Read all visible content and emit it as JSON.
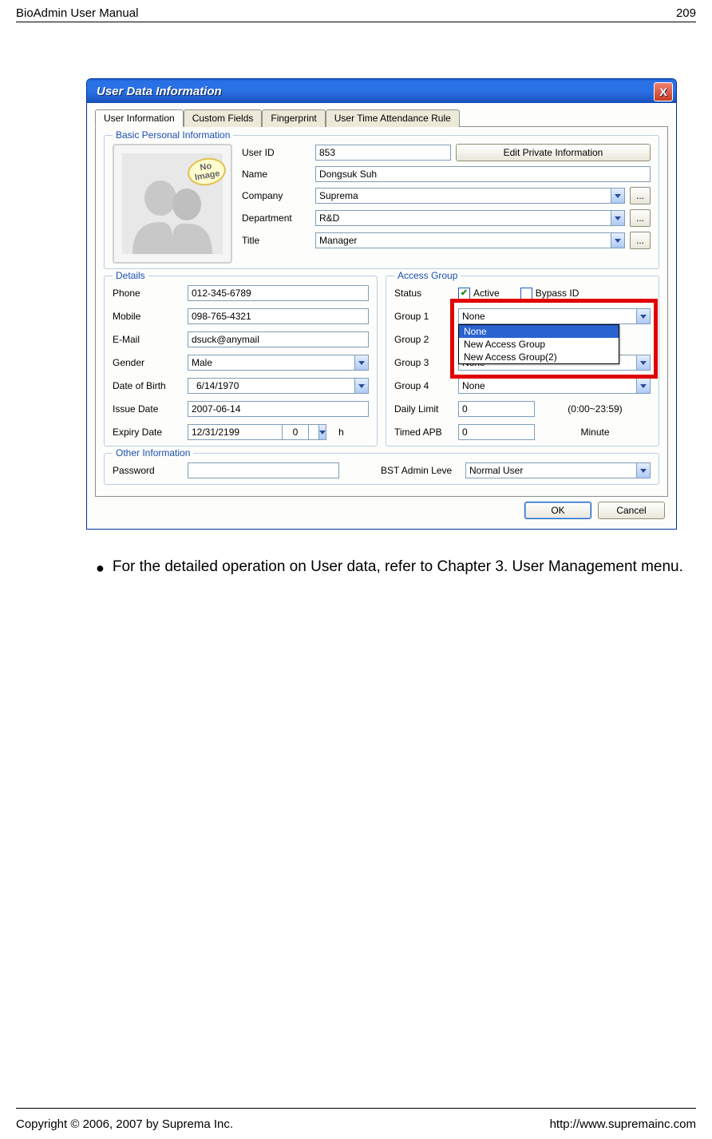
{
  "page": {
    "header_left": "BioAdmin User Manual",
    "header_right": "209",
    "footer_left": "Copyright © 2006, 2007 by Suprema Inc.",
    "footer_right": "http://www.supremainc.com"
  },
  "bullet_text": "For the detailed operation on User data, refer to Chapter 3. User Management menu.",
  "window": {
    "title": "User Data Information",
    "close_label": "X",
    "tabs": [
      {
        "label": "User Information",
        "active": true
      },
      {
        "label": "Custom Fields",
        "active": false
      },
      {
        "label": "Fingerprint",
        "active": false
      },
      {
        "label": "User Time Attendance Rule",
        "active": false
      }
    ],
    "groups": {
      "basic": {
        "legend": "Basic Personal Information",
        "no_image": "No Image",
        "btn_edit": "Edit Private Information",
        "user_id_label": "User ID",
        "user_id_value": "853",
        "name_label": "Name",
        "name_value": "Dongsuk Suh",
        "company_label": "Company",
        "company_value": "Suprema",
        "department_label": "Department",
        "department_value": "R&D",
        "title_label": "Title",
        "title_value": "Manager"
      },
      "details": {
        "legend": "Details",
        "phone_label": "Phone",
        "phone_value": "012-345-6789",
        "mobile_label": "Mobile",
        "mobile_value": "098-765-4321",
        "email_label": "E-Mail",
        "email_value": "dsuck@anymail",
        "gender_label": "Gender",
        "gender_value": "Male",
        "dob_label": "Date of Birth",
        "dob_value": "6/14/1970",
        "issue_label": "Issue Date",
        "issue_value": "2007-06-14",
        "expiry_label": "Expiry Date",
        "expiry_value": "12/31/2199",
        "expiry_hours": "0",
        "expiry_hours_unit": "h"
      },
      "access": {
        "legend": "Access Group",
        "status_label": "Status",
        "active_label": "Active",
        "active_checked": true,
        "bypass_label": "Bypass ID",
        "bypass_checked": false,
        "group1_label": "Group 1",
        "group1_value": "None",
        "group1_options": [
          "None",
          "New Access Group",
          "New Access Group(2)"
        ],
        "group1_selected_option": "None",
        "group2_label": "Group 2",
        "group3_label": "Group 3",
        "group3_value": "None",
        "group4_label": "Group 4",
        "group4_value": "None",
        "daily_limit_label": "Daily Limit",
        "daily_limit_value": "0",
        "daily_limit_hint": "(0:00~23:59)",
        "timed_apb_label": "Timed APB",
        "timed_apb_value": "0",
        "timed_apb_unit": "Minute"
      },
      "other": {
        "legend": "Other Information",
        "password_label": "Password",
        "password_value": "",
        "bst_label": "BST Admin Leve",
        "bst_value": "Normal User"
      }
    },
    "buttons": {
      "ok": "OK",
      "cancel": "Cancel",
      "more": "..."
    }
  }
}
